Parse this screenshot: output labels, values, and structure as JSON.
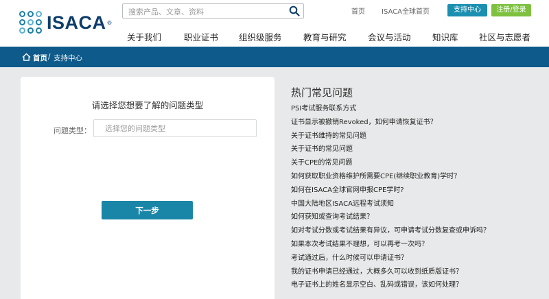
{
  "header": {
    "logo_text": "ISACA",
    "logo_tm": "®",
    "search_placeholder": "搜索产品、文章、资料",
    "top_links": [
      "首页",
      "ISACA全球首页"
    ],
    "support_button": "支持中心",
    "login_button": "注册/登录",
    "nav": [
      "关于我们",
      "职业证书",
      "组织级服务",
      "教育与研究",
      "会议与活动",
      "知识库",
      "社区与志愿者"
    ]
  },
  "breadcrumb": {
    "home": "首页",
    "separator": "/",
    "current": "支持中心"
  },
  "form": {
    "title": "请选择您想要了解的问题类型",
    "label": "问题类型：",
    "placeholder": "选择您的问题类型",
    "next_button": "下一步"
  },
  "faq": {
    "title": "热门常见问题",
    "items": [
      "PSI考试服务联系方式",
      "证书显示被撤销Revoked，如何申请恢复证书？",
      "关于证书维持的常见问题",
      "关于证书的常见问题",
      "关于CPE的常见问题",
      "如何获取职业资格维护所需要CPE(继续职业教育)学时？",
      "如何在ISACA全球官网申报CPE学时?",
      "中国大陆地区ISACA远程考试须知",
      "如何获知或查询考试结果？",
      "如对考试分数或考试结果有异议，可申请考试分数复查或申诉吗？",
      "如果本次考试结果不理想，可以再考一次吗？",
      "考试通过后，什么时候可以申请证书？",
      "我的证书申请已经通过，大概多久可以收到纸质版证书？",
      "电子证书上的姓名显示空白、乱码或错误，该如何处理？"
    ]
  },
  "colors": {
    "brand_blue": "#0e5a8a",
    "teal": "#1a86a7",
    "green": "#7dc13e",
    "logo_navy": "#0e3d6b"
  }
}
